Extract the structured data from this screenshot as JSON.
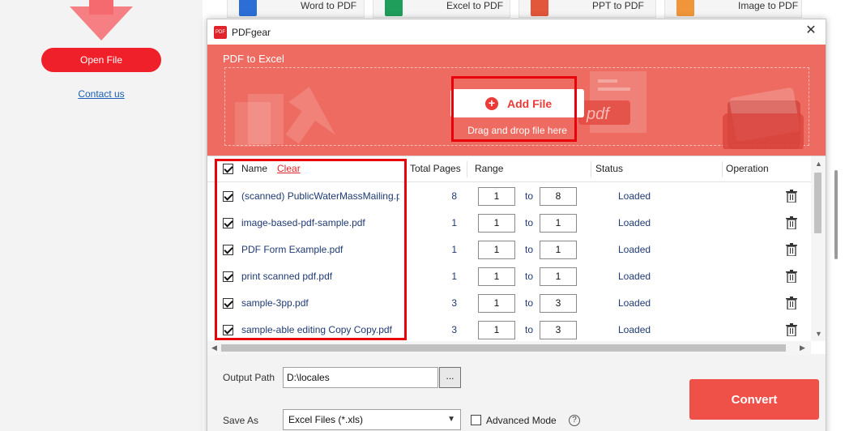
{
  "background": {
    "open_file_label": "Open File",
    "contact_label": "Contact us",
    "tool_tabs": [
      {
        "label": "Word to PDF",
        "icon": "word-icon",
        "color": "#2b6fd6"
      },
      {
        "label": "Excel to PDF",
        "icon": "excel-icon",
        "color": "#1f9d5b"
      },
      {
        "label": "PPT to PDF",
        "icon": "ppt-icon",
        "color": "#e2563a"
      },
      {
        "label": "Image to PDF",
        "icon": "image-icon",
        "color": "#f0953a"
      }
    ]
  },
  "dialog": {
    "app_title": "PDFgear",
    "section_title": "PDF to Excel",
    "add_file_label": "Add File",
    "drag_hint": "Drag and drop file here",
    "hero_doc_text": "pdf",
    "accent_color": "#ee6b61"
  },
  "table": {
    "headers": {
      "name": "Name",
      "clear": "Clear",
      "total_pages": "Total Pages",
      "range": "Range",
      "status": "Status",
      "operation": "Operation"
    },
    "range_sep": "to",
    "rows": [
      {
        "name": "(scanned) PublicWaterMassMailing.pdf",
        "pages": "8",
        "from": "1",
        "to": "8",
        "status": "Loaded"
      },
      {
        "name": "image-based-pdf-sample.pdf",
        "pages": "1",
        "from": "1",
        "to": "1",
        "status": "Loaded"
      },
      {
        "name": "PDF Form Example.pdf",
        "pages": "1",
        "from": "1",
        "to": "1",
        "status": "Loaded"
      },
      {
        "name": "print scanned pdf.pdf",
        "pages": "1",
        "from": "1",
        "to": "1",
        "status": "Loaded"
      },
      {
        "name": "sample-3pp.pdf",
        "pages": "3",
        "from": "1",
        "to": "3",
        "status": "Loaded"
      },
      {
        "name": "sample-able editing Copy Copy.pdf",
        "pages": "3",
        "from": "1",
        "to": "3",
        "status": "Loaded"
      }
    ]
  },
  "footer": {
    "output_label": "Output Path",
    "output_value": "D:\\locales",
    "browse_label": "...",
    "save_label": "Save As",
    "save_value": "Excel Files (*.xls)",
    "advanced_label": "Advanced Mode",
    "help_glyph": "?",
    "convert_label": "Convert"
  }
}
